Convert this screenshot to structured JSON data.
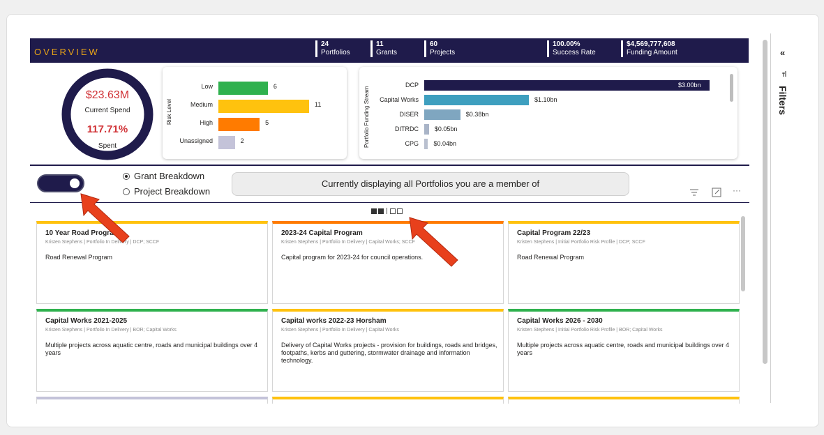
{
  "header": {
    "title": "OVERVIEW",
    "kpis": [
      {
        "value": "24",
        "label": "Portfolios"
      },
      {
        "value": "11",
        "label": "Grants"
      },
      {
        "value": "60",
        "label": "Projects"
      },
      {
        "value": "100.00%",
        "label": "Success Rate"
      },
      {
        "value": "$4,569,777,608",
        "label": "Funding Amount"
      }
    ]
  },
  "spend": {
    "current_spend": "$23.63M",
    "current_spend_label": "Current Spend",
    "spent_pct": "117.71%",
    "spent_label": "Spent"
  },
  "risk_chart": {
    "axis_label": "Risk Level",
    "categories": [
      "Low",
      "Medium",
      "High",
      "Unassigned"
    ],
    "values": [
      6,
      11,
      5,
      2
    ],
    "value_labels": [
      "6",
      "11",
      "5",
      "2"
    ],
    "colors": [
      "#2fb14e",
      "#ffc20e",
      "#ff7b00",
      "#c4c3d9"
    ],
    "xlim": [
      0,
      11
    ]
  },
  "stream_chart": {
    "axis_label": "Portfolio Funding Stream",
    "categories": [
      "DCP",
      "Capital Works",
      "DISER",
      "DITRDC",
      "CPG"
    ],
    "values": [
      3.0,
      1.1,
      0.38,
      0.05,
      0.04
    ],
    "value_labels": [
      "$3.00bn",
      "$1.10bn",
      "$0.38bn",
      "$0.05bn",
      "$0.04bn"
    ],
    "colors": [
      "#1f1b4b",
      "#3e9fbf",
      "#7fa6c0",
      "#a9b4c7",
      "#b9c0cf"
    ],
    "xlim": [
      0,
      3.0
    ]
  },
  "view": {
    "radio_grant": "Grant Breakdown",
    "radio_project": "Project Breakdown",
    "banner": "Currently displaying all Portfolios you are a member of",
    "more": "···"
  },
  "tiles": [
    {
      "title": "10 Year Road Program",
      "sub": "Kristen Stephens | Portfolio In Delivery | DCP; SCCF",
      "desc": "Road Renewal Program",
      "color": "#ffc20e"
    },
    {
      "title": "2023-24 Capital Program",
      "sub": "Kristen Stephens | Portfolio In Delivery | Capital Works; SCCF",
      "desc": "Capital program for 2023-24 for council operations.",
      "color": "#ff7b00"
    },
    {
      "title": "Capital Program 22/23",
      "sub": "Kristen Stephens | Initial Portfolio Risk Profile | DCP; SCCF",
      "desc": "Road Renewal Program",
      "color": "#ffc20e"
    },
    {
      "title": "Capital Works 2021-2025",
      "sub": "Kristen Stephens | Portfolio In Delivery | BOR; Capital Works",
      "desc": "Multiple projects across aquatic centre, roads and municipal buildings over 4 years",
      "color": "#2fb14e"
    },
    {
      "title": "Capital works 2022-23 Horsham",
      "sub": "Kristen Stephens | Portfolio In Delivery | Capital Works",
      "desc": "Delivery of Capital Works projects - provision for buildings, roads and bridges, footpaths, kerbs and guttering, stormwater drainage and information technology.",
      "color": "#ffc20e"
    },
    {
      "title": "Capital Works 2026 - 2030",
      "sub": "Kristen Stephens | Initial Portfolio Risk Profile | BOR; Capital Works",
      "desc": "Multiple projects across aquatic centre, roads and municipal buildings over 4 years",
      "color": "#2fb14e"
    }
  ],
  "partial_tile_colors": [
    "#c4c3d9",
    "#ffc20e",
    "#ffc20e"
  ],
  "panel": {
    "filters_label": "Filters",
    "collapse_icon": "«"
  }
}
